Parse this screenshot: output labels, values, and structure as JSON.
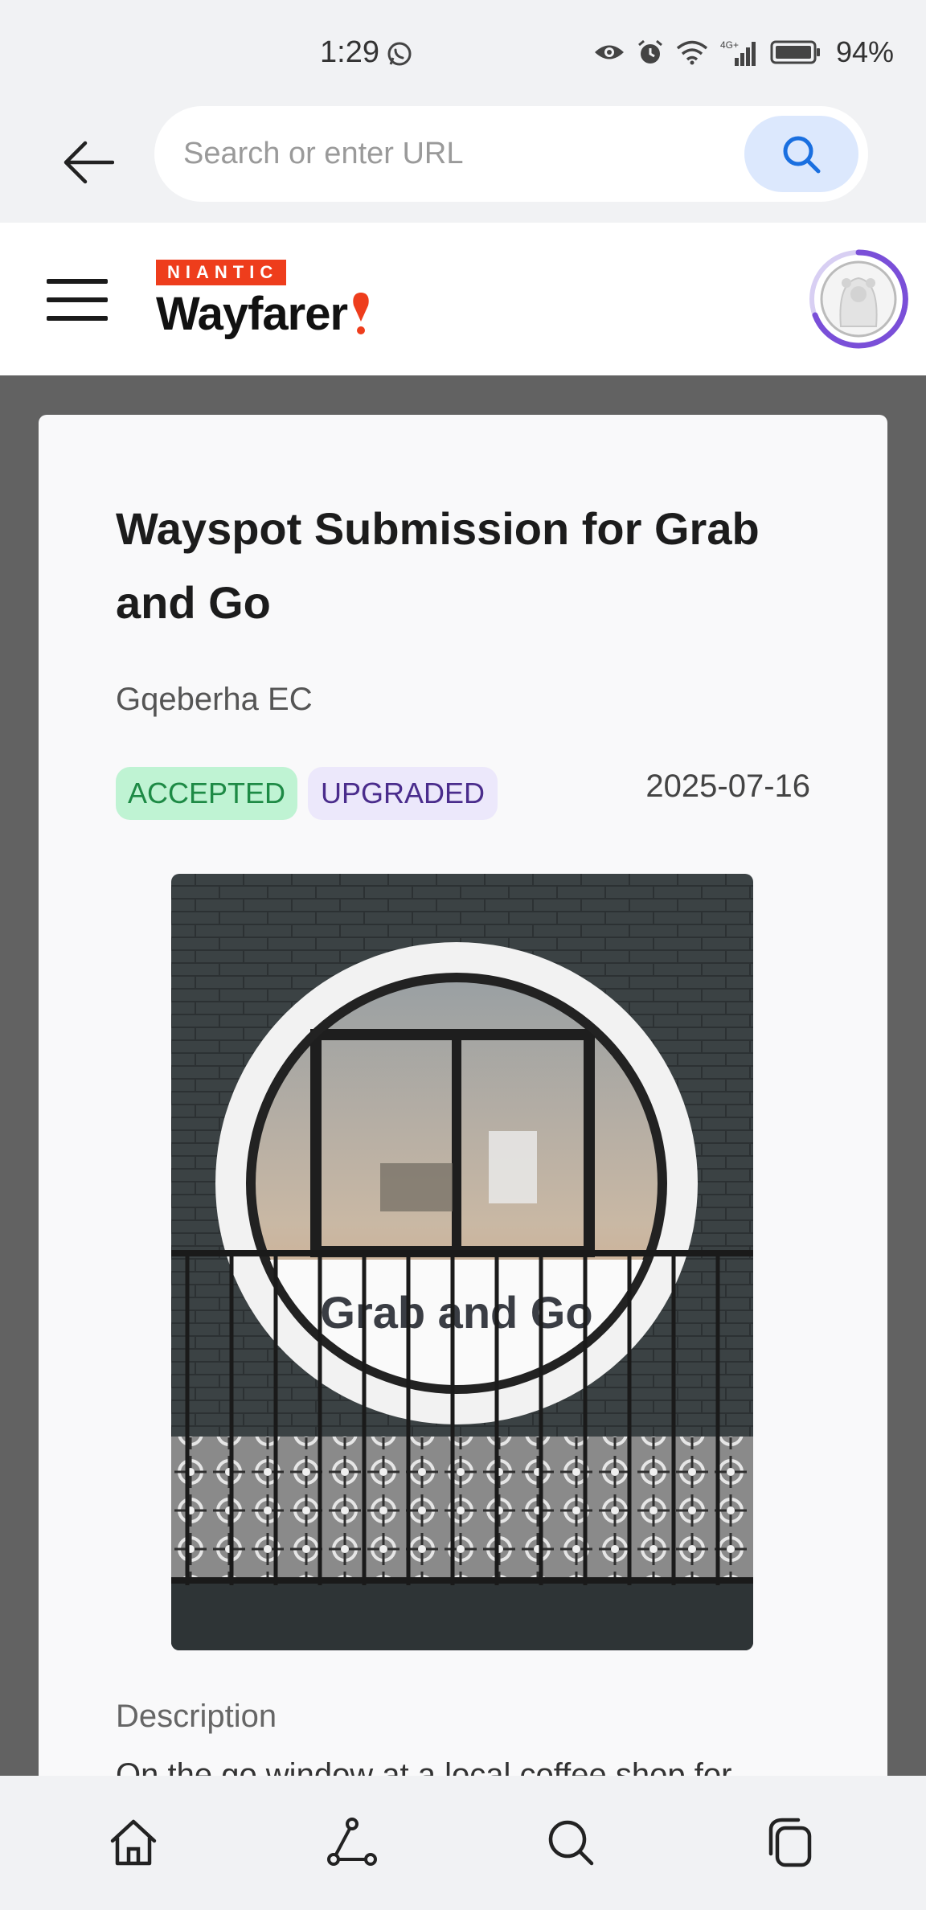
{
  "status_bar": {
    "time": "1:29",
    "battery": "94%",
    "network_label": "4G+"
  },
  "browser": {
    "url_placeholder": "Search or enter URL"
  },
  "header": {
    "brand_small": "NIANTIC",
    "brand_main": "Wayfarer"
  },
  "submission": {
    "title_prefix": "Wayspot Submission for ",
    "title_name": "Grab and Go",
    "location": "Gqeberha EC",
    "status_badge": "ACCEPTED",
    "upgrade_badge": "UPGRADED",
    "date": "2025-07-16",
    "photo_sign_text": "Grab and Go",
    "description_label": "Description",
    "description_text": "On the go window at a local coffee shop for"
  },
  "colors": {
    "accent_blue": "#1a6fe0",
    "niantic_red": "#ee3d1c",
    "accepted_bg": "#bff3d3",
    "upgraded_bg": "#ece8fb",
    "avatar_ring": "#7a4fd8"
  }
}
